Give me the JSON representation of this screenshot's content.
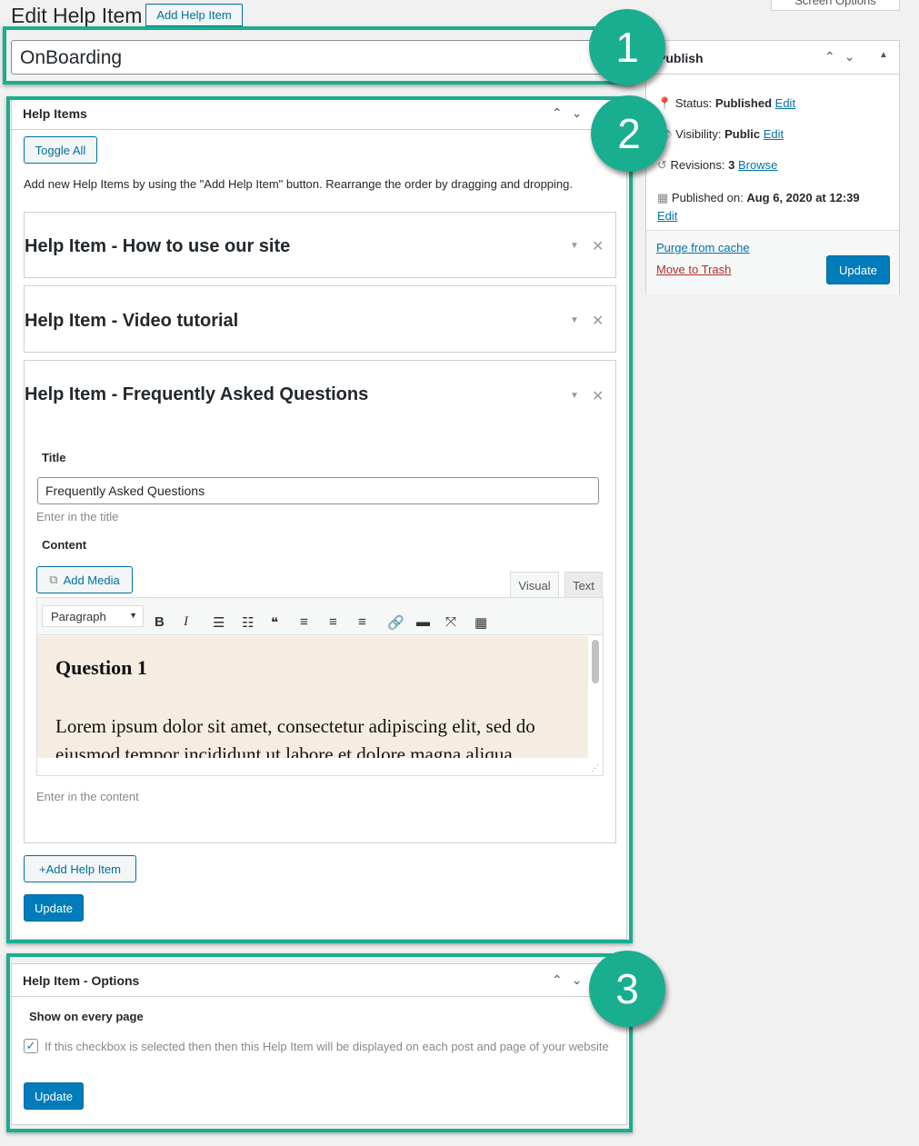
{
  "header": {
    "title": "Edit Help Item",
    "add_button": "Add Help Item",
    "screen_options": "Screen Options"
  },
  "post_title": "OnBoarding",
  "annotations": [
    "1",
    "2",
    "3"
  ],
  "accent_color": "#19ae8f",
  "help_items_box": {
    "title": "Help Items",
    "toggle_all": "Toggle All",
    "description": "Add new Help Items by using the \"Add Help Item\" button. Rearrange the order by dragging and dropping.",
    "items": [
      {
        "heading": "Help Item - How to use our site"
      },
      {
        "heading": "Help Item - Video tutorial"
      },
      {
        "heading": "Help Item - Frequently Asked Questions"
      }
    ],
    "expanded": {
      "title_label": "Title",
      "title_value": "Frequently Asked Questions",
      "title_hint": "Enter in the title",
      "content_label": "Content",
      "add_media": "Add Media",
      "tab_visual": "Visual",
      "tab_text": "Text",
      "format_select": "Paragraph",
      "toolbar_icons": [
        "bold-icon",
        "italic-icon",
        "bullet-list-icon",
        "numbered-list-icon",
        "blockquote-icon",
        "align-left-icon",
        "align-center-icon",
        "align-right-icon",
        "link-icon",
        "read-more-icon",
        "fullscreen-icon",
        "toolbar-toggle-icon"
      ],
      "editor_heading": "Question 1",
      "editor_text": "Lorem ipsum dolor sit amet, consectetur adipiscing elit, sed do eiusmod tempor incididunt ut labore et dolore magna aliqua.",
      "content_hint": "Enter in the content"
    },
    "add_help_item": "Add Help Item",
    "update": "Update"
  },
  "publish": {
    "title": "Publish",
    "status_label": "Status:",
    "status_value": "Published",
    "edit": "Edit",
    "visibility_label": "Visibility:",
    "visibility_value": "Public",
    "revisions_label": "Revisions:",
    "revisions_value": "3",
    "browse": "Browse",
    "published_label": "Published on:",
    "published_value": "Aug 6, 2020 at 12:39",
    "purge": "Purge from cache",
    "trash": "Move to Trash",
    "update": "Update"
  },
  "options_box": {
    "title": "Help Item - Options",
    "show_label": "Show on every page",
    "checkbox_checked": true,
    "checkbox_text": "If this checkbox is selected then then this Help Item will be displayed on each post and page of your website",
    "update": "Update"
  }
}
